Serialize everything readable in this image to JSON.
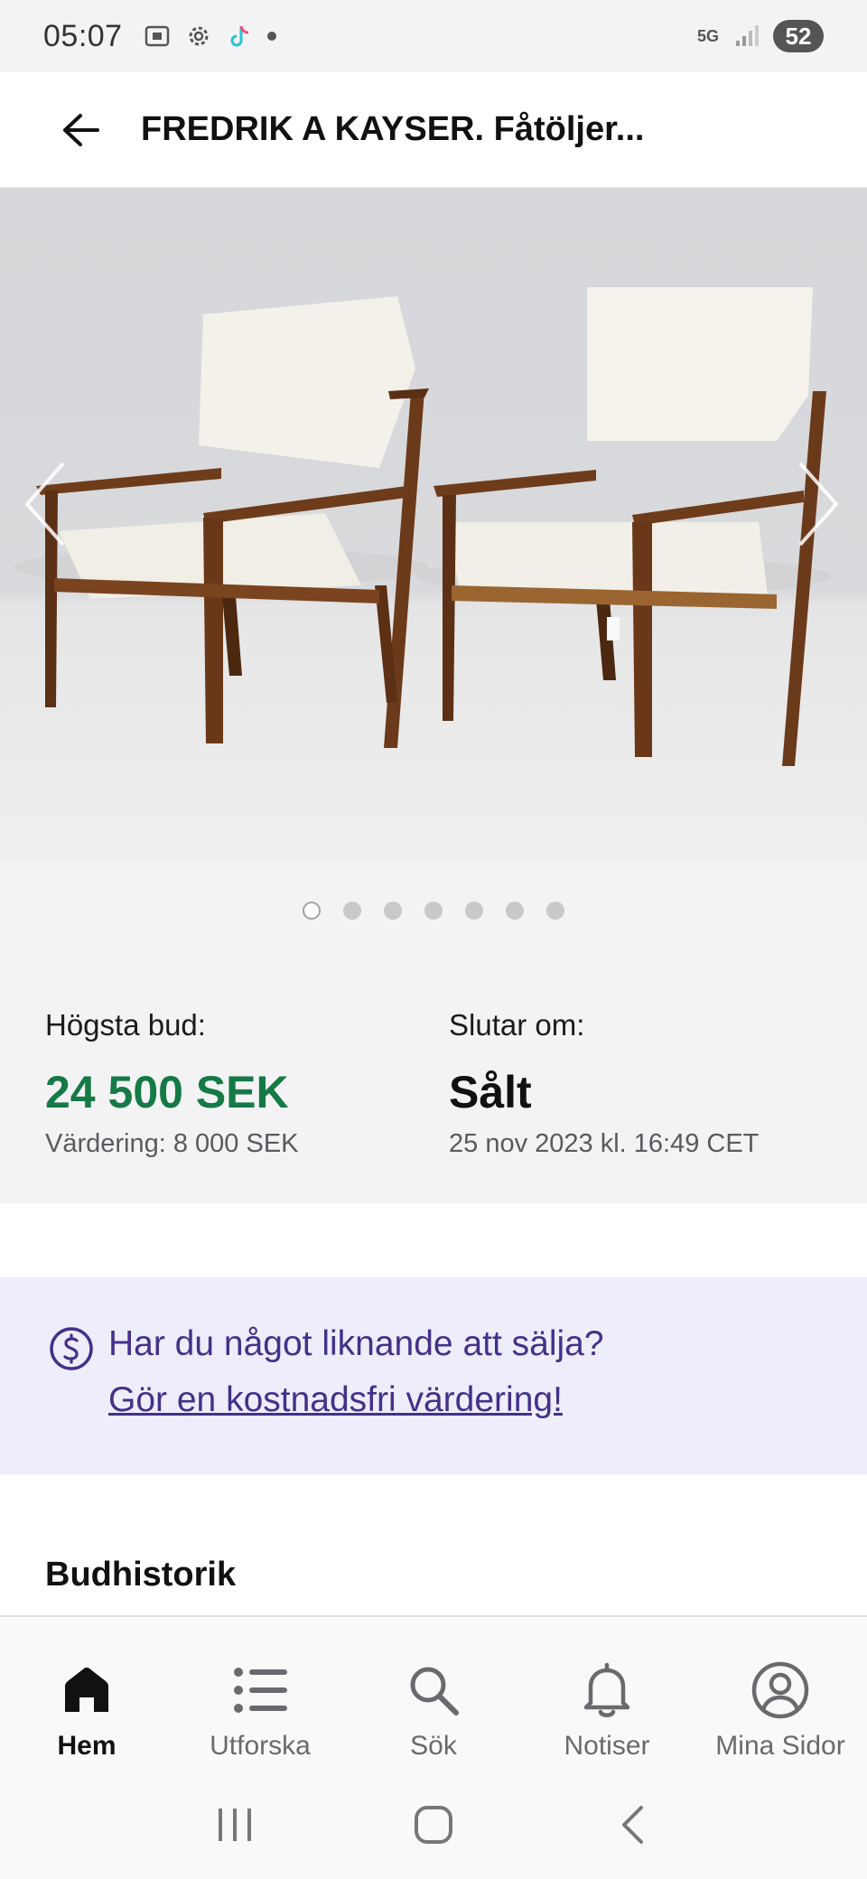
{
  "status_bar": {
    "time": "05:07",
    "network": "5G",
    "battery": "52"
  },
  "header": {
    "title": "FREDRIK A KAYSER. Fåtöljer..."
  },
  "gallery": {
    "image_count": 7,
    "active_index": 0
  },
  "bid": {
    "highest_label": "Högsta bud:",
    "highest_amount": "24 500 SEK",
    "valuation": "Värdering: 8 000 SEK",
    "ends_label": "Slutar om:",
    "status": "Sålt",
    "end_time": "25 nov 2023 kl. 16:49 CET"
  },
  "promo": {
    "question": "Har du något liknande att sälja?",
    "link": "Gör en kostnadsfri värdering!"
  },
  "sections": {
    "bid_history_title": "Budhistorik"
  },
  "nav": {
    "items": [
      {
        "label": "Hem",
        "icon": "home-icon",
        "active": true
      },
      {
        "label": "Utforska",
        "icon": "list-icon",
        "active": false
      },
      {
        "label": "Sök",
        "icon": "search-icon",
        "active": false
      },
      {
        "label": "Notiser",
        "icon": "bell-icon",
        "active": false
      },
      {
        "label": "Mina Sidor",
        "icon": "user-icon",
        "active": false
      }
    ]
  },
  "colors": {
    "accent_green": "#157a45",
    "promo_purple": "#45308a",
    "promo_bg": "#ededfb"
  }
}
